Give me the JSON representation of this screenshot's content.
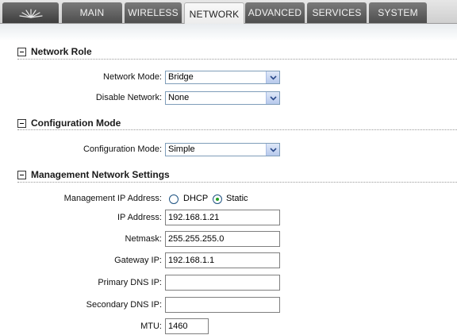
{
  "tabs": {
    "logo_icon": "ubiquiti-logo-icon",
    "items": [
      {
        "label": "MAIN"
      },
      {
        "label": "WIRELESS"
      },
      {
        "label": "NETWORK"
      },
      {
        "label": "ADVANCED"
      },
      {
        "label": "SERVICES"
      },
      {
        "label": "SYSTEM"
      }
    ],
    "active": "NETWORK"
  },
  "sections": {
    "network_role": {
      "title": "Network Role",
      "network_mode": {
        "label": "Network Mode:",
        "value": "Bridge"
      },
      "disable_network": {
        "label": "Disable Network:",
        "value": "None"
      }
    },
    "configuration_mode": {
      "title": "Configuration Mode",
      "configuration_mode": {
        "label": "Configuration Mode:",
        "value": "Simple"
      }
    },
    "management_network": {
      "title": "Management Network Settings",
      "ip_address_mode": {
        "label": "Management IP Address:",
        "options": [
          "DHCP",
          "Static"
        ],
        "selected": "Static"
      },
      "ip_address": {
        "label": "IP Address:",
        "value": "192.168.1.21"
      },
      "netmask": {
        "label": "Netmask:",
        "value": "255.255.255.0"
      },
      "gateway_ip": {
        "label": "Gateway IP:",
        "value": "192.168.1.1"
      },
      "primary_dns": {
        "label": "Primary DNS IP:",
        "value": ""
      },
      "secondary_dns": {
        "label": "Secondary DNS IP:",
        "value": ""
      },
      "mtu": {
        "label": "MTU:",
        "value": "1460"
      }
    }
  },
  "colors": {
    "tab_inactive": "#5a5a5a",
    "tab_active": "#f2f2f2",
    "radio_selected": "#21a121",
    "select_border": "#7f9db9"
  }
}
